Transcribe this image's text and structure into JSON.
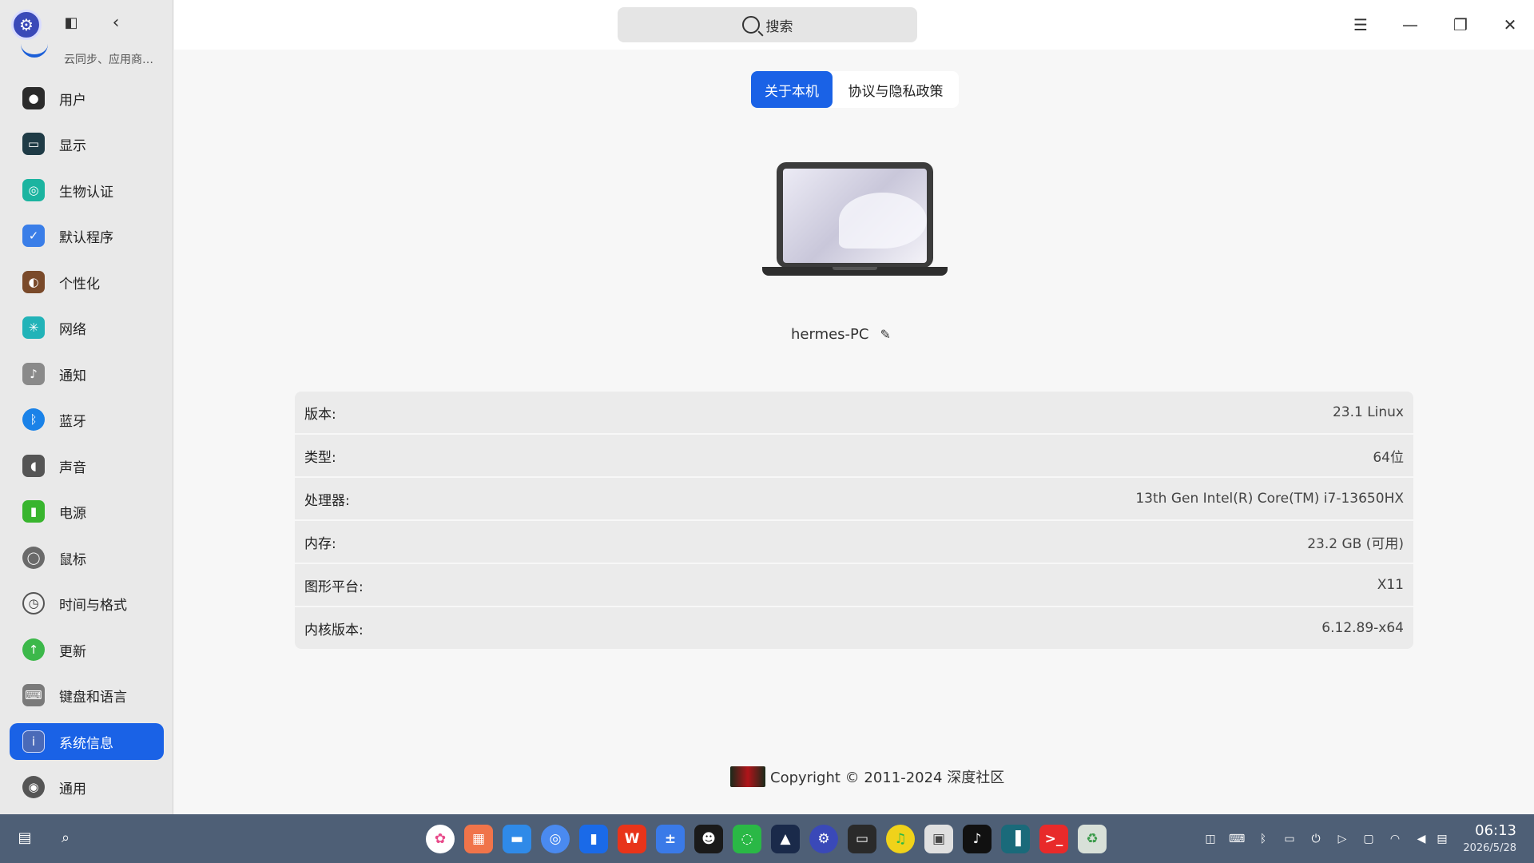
{
  "sidebar": {
    "cloud_subtitle": "云同步、应用商…",
    "items": [
      {
        "label": "用户",
        "icon": "user-icon",
        "color": "#2b2b2b"
      },
      {
        "label": "显示",
        "icon": "monitor-icon",
        "color": "#1f3b46"
      },
      {
        "label": "生物认证",
        "icon": "fingerprint-icon",
        "color": "#1bb4a0"
      },
      {
        "label": "默认程序",
        "icon": "default-apps-icon",
        "color": "#3a7ee8"
      },
      {
        "label": "个性化",
        "icon": "palette-icon",
        "color": "#7a4a2a"
      },
      {
        "label": "网络",
        "icon": "network-icon",
        "color": "#22b3b8"
      },
      {
        "label": "通知",
        "icon": "bell-icon",
        "color": "#8a8a8a"
      },
      {
        "label": "蓝牙",
        "icon": "bluetooth-icon",
        "color": "#1a82e8"
      },
      {
        "label": "声音",
        "icon": "speaker-icon",
        "color": "#555555"
      },
      {
        "label": "电源",
        "icon": "battery-icon",
        "color": "#38b52e"
      },
      {
        "label": "鼠标",
        "icon": "mouse-icon",
        "color": "#6a6a6a"
      },
      {
        "label": "时间与格式",
        "icon": "clock-icon",
        "color": "#f0f0f0"
      },
      {
        "label": "更新",
        "icon": "update-icon",
        "color": "#3cb84a"
      },
      {
        "label": "键盘和语言",
        "icon": "keyboard-icon",
        "color": "#7a7a7a"
      },
      {
        "label": "系统信息",
        "icon": "info-icon",
        "color": "#4a6ab8"
      },
      {
        "label": "通用",
        "icon": "general-icon",
        "color": "#555555"
      }
    ],
    "active_index": 14
  },
  "titlebar": {
    "search_placeholder": "搜索",
    "buttons": [
      "menu-icon",
      "minimize-icon",
      "restore-icon",
      "close-icon"
    ]
  },
  "tabs": [
    {
      "label": "关于本机",
      "active": true
    },
    {
      "label": "协议与隐私政策",
      "active": false
    }
  ],
  "hostname": "hermes-PC",
  "info_rows": [
    {
      "key": "版本:",
      "value": "23.1 Linux"
    },
    {
      "key": "类型:",
      "value": "64位"
    },
    {
      "key": "处理器:",
      "value": "13th Gen Intel(R) Core(TM) i7-13650HX"
    },
    {
      "key": "内存:",
      "value": "23.2 GB (可用)"
    },
    {
      "key": "图形平台:",
      "value": "X11"
    },
    {
      "key": "内核版本:",
      "value": "6.12.89-x64"
    }
  ],
  "copyright": "Copyright © 2011-2024 深度社区",
  "dock": {
    "apps": [
      {
        "name": "launcher-icon",
        "color": "#ffffff"
      },
      {
        "name": "multitask-icon",
        "color": "#f0744a"
      },
      {
        "name": "file-manager-icon",
        "color": "#2f8ae8"
      },
      {
        "name": "browser-icon",
        "color": "#4a8af0"
      },
      {
        "name": "app-store-icon",
        "color": "#1a6ae8"
      },
      {
        "name": "wps-icon",
        "color": "#e8341a"
      },
      {
        "name": "calculator-icon",
        "color": "#3a7ae8"
      },
      {
        "name": "terminal-figure-icon",
        "color": "#1a1a1a"
      },
      {
        "name": "wechat-icon",
        "color": "#2ab846"
      },
      {
        "name": "vector-icon",
        "color": "#1a2a4a"
      },
      {
        "name": "settings-icon",
        "color": "#3a49b8"
      },
      {
        "name": "scanner-icon",
        "color": "#2a2a2a"
      },
      {
        "name": "qq-music-icon",
        "color": "#f0d21a"
      },
      {
        "name": "archive-icon",
        "color": "#e0e0e0"
      },
      {
        "name": "tiktok-icon",
        "color": "#111111"
      },
      {
        "name": "book-icon",
        "color": "#1a6a7a"
      },
      {
        "name": "remote-terminal-icon",
        "color": "#e82a2a"
      },
      {
        "name": "trash-icon",
        "color": "#d8e0d8"
      }
    ],
    "clock_time": "06:13",
    "clock_date": "2026/5/28"
  }
}
